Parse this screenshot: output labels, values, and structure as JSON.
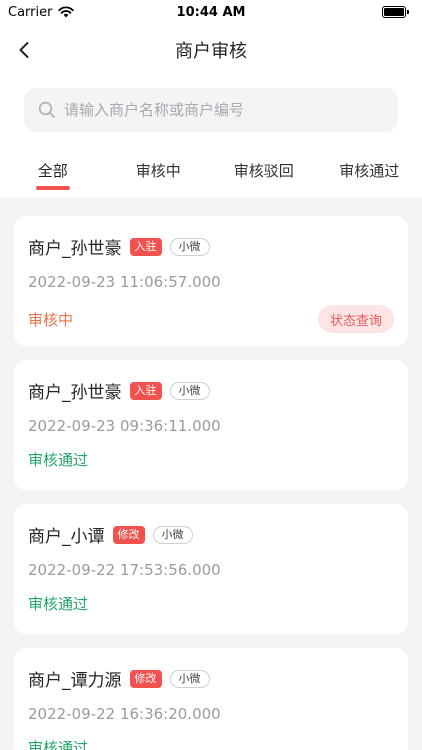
{
  "status_bar": {
    "carrier": "Carrier",
    "time": "10:44 AM"
  },
  "nav": {
    "title": "商户审核"
  },
  "search": {
    "placeholder": "请输入商户名称或商户编号"
  },
  "tabs": [
    {
      "label": "全部"
    },
    {
      "label": "审核中"
    },
    {
      "label": "审核驳回"
    },
    {
      "label": "审核通过"
    }
  ],
  "cards": [
    {
      "name": "商户_孙世豪",
      "type_tag": "入驻",
      "kind_tag": "小微",
      "time": "2022-09-23 11:06:57.000",
      "status": "审核中",
      "action": "状态查询"
    },
    {
      "name": "商户_孙世豪",
      "type_tag": "入驻",
      "kind_tag": "小微",
      "time": "2022-09-23 09:36:11.000",
      "status": "审核通过"
    },
    {
      "name": "商户_小谭",
      "type_tag": "修改",
      "kind_tag": "小微",
      "time": "2022-09-22 17:53:56.000",
      "status": "审核通过"
    },
    {
      "name": "商户_谭力源",
      "type_tag": "修改",
      "kind_tag": "小微",
      "time": "2022-09-22 16:36:20.000",
      "status": "审核通过"
    }
  ],
  "colors": {
    "accent": "#f0524f",
    "pending": "#e8734a",
    "passed": "#23a566"
  }
}
